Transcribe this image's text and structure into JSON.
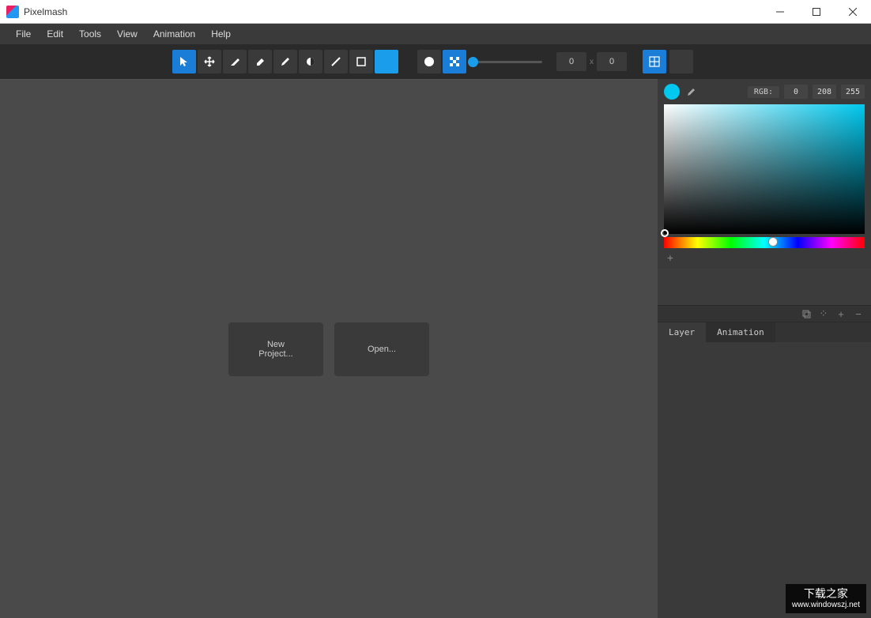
{
  "app": {
    "title": "Pixelmash"
  },
  "menu": {
    "file": "File",
    "edit": "Edit",
    "tools": "Tools",
    "view": "View",
    "animation": "Animation",
    "help": "Help"
  },
  "toolbar": {
    "size_x": "0",
    "size_y": "0",
    "times": "x"
  },
  "canvas": {
    "new_project": "New\nProject...",
    "open": "Open..."
  },
  "color": {
    "rgb_label": "RGB:",
    "r": "0",
    "g": "208",
    "b": "255"
  },
  "panel": {
    "tab_layer": "Layer",
    "tab_animation": "Animation"
  },
  "watermark": {
    "main": "下载之家",
    "sub": "www.windowszj.net"
  }
}
